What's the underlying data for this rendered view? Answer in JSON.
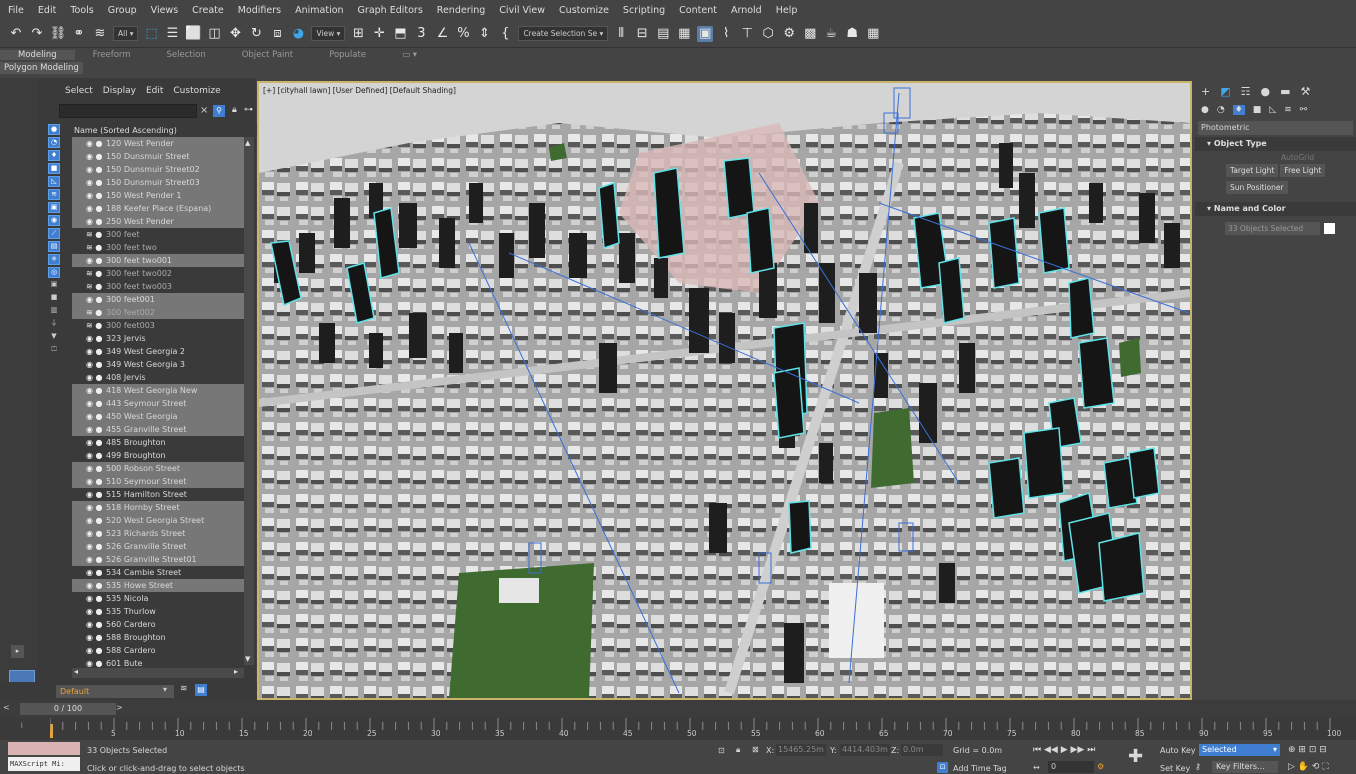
{
  "menu": [
    "File",
    "Edit",
    "Tools",
    "Group",
    "Views",
    "Create",
    "Modifiers",
    "Animation",
    "Graph Editors",
    "Rendering",
    "Civil View",
    "Customize",
    "Scripting",
    "Content",
    "Arnold",
    "Help"
  ],
  "toolbar": {
    "filter_select": "All",
    "view_select": "View",
    "selection_set": "Create Selection Se"
  },
  "ribbon": {
    "tabs": [
      "Modeling",
      "Freeform",
      "Selection",
      "Object Paint",
      "Populate"
    ],
    "active_tab": "Modeling",
    "sub_label": "Polygon Modeling"
  },
  "scene_explorer": {
    "menu": [
      "Select",
      "Display",
      "Edit",
      "Customize"
    ],
    "column_header": "Name (Sorted Ascending)",
    "items": [
      {
        "name": "120 West Pender",
        "type": "light",
        "state": "sel"
      },
      {
        "name": "150 Dunsmuir Street",
        "type": "light",
        "state": "sel"
      },
      {
        "name": "150 Dunsmuir Street02",
        "type": "light",
        "state": "sel"
      },
      {
        "name": "150 Dunsmuir Street03",
        "type": "light",
        "state": "sel"
      },
      {
        "name": "150 West Pender 1",
        "type": "light",
        "state": "sel"
      },
      {
        "name": "188 Keefer Place (Espana)",
        "type": "light",
        "state": "sel"
      },
      {
        "name": "250 West Pender",
        "type": "light",
        "state": "sel"
      },
      {
        "name": "300 feet",
        "type": "layer",
        "state": "dim"
      },
      {
        "name": "300 feet two",
        "type": "layer",
        "state": "dim"
      },
      {
        "name": "300 feet two001",
        "type": "light",
        "state": "sel"
      },
      {
        "name": "300 feet two002",
        "type": "layer",
        "state": "dim"
      },
      {
        "name": "300 feet two003",
        "type": "layer",
        "state": "dim"
      },
      {
        "name": "300 feet001",
        "type": "light",
        "state": "sel"
      },
      {
        "name": "300 feet002",
        "type": "layer",
        "state": "dimsel"
      },
      {
        "name": "300 feet003",
        "type": "layer",
        "state": "dim"
      },
      {
        "name": "323 Jervis",
        "type": "light",
        "state": "plain"
      },
      {
        "name": "349 West Georgia 2",
        "type": "light",
        "state": "plain"
      },
      {
        "name": "349 West Georgia 3",
        "type": "light",
        "state": "plain"
      },
      {
        "name": "408 Jervis",
        "type": "light",
        "state": "plain"
      },
      {
        "name": "418 West Georgia New",
        "type": "light",
        "state": "sel"
      },
      {
        "name": "443 Seymour Street",
        "type": "light",
        "state": "sel"
      },
      {
        "name": "450 West Georgia",
        "type": "light",
        "state": "sel"
      },
      {
        "name": "455 Granville Street",
        "type": "light",
        "state": "sel"
      },
      {
        "name": "485 Broughton",
        "type": "light",
        "state": "plain"
      },
      {
        "name": "499 Broughton",
        "type": "light",
        "state": "plain"
      },
      {
        "name": "500 Robson Street",
        "type": "light",
        "state": "sel"
      },
      {
        "name": "510 Seymour Street",
        "type": "light",
        "state": "sel"
      },
      {
        "name": "515 Hamilton Street",
        "type": "light",
        "state": "plain"
      },
      {
        "name": "518 Hornby Street",
        "type": "light",
        "state": "sel"
      },
      {
        "name": "520 West Georgia Street",
        "type": "light",
        "state": "sel"
      },
      {
        "name": "523 Richards Street",
        "type": "light",
        "state": "sel"
      },
      {
        "name": "526 Granville Street",
        "type": "light",
        "state": "sel"
      },
      {
        "name": "526 Granville Street01",
        "type": "light",
        "state": "sel"
      },
      {
        "name": "534 Cambie Street",
        "type": "light",
        "state": "plain"
      },
      {
        "name": "535 Howe Street",
        "type": "light",
        "state": "sel"
      },
      {
        "name": "535 Nicola",
        "type": "light",
        "state": "plain"
      },
      {
        "name": "535 Thurlow",
        "type": "light",
        "state": "plain"
      },
      {
        "name": "560 Cardero",
        "type": "light",
        "state": "plain"
      },
      {
        "name": "588 Broughton",
        "type": "light",
        "state": "plain"
      },
      {
        "name": "588 Cardero",
        "type": "light",
        "state": "plain"
      },
      {
        "name": "601 Bute",
        "type": "light",
        "state": "plain"
      }
    ],
    "layer": "Default"
  },
  "viewport": {
    "label": "[+] [cityhall lawn] [User Defined] [Default Shading]"
  },
  "command_panel": {
    "category": "Photometric",
    "object_type_title": "Object Type",
    "autogrid": "AutoGrid",
    "buttons": [
      "Target Light",
      "Free Light",
      "Sun Positioner"
    ],
    "name_color_title": "Name and Color",
    "name_field": "33 Objects Selected"
  },
  "timeline": {
    "frame": "0 / 100",
    "ticks": [
      "5",
      "10",
      "15",
      "20",
      "25",
      "30",
      "35",
      "40",
      "45",
      "50",
      "55",
      "60",
      "65",
      "70",
      "75",
      "80",
      "85",
      "90",
      "95",
      "100"
    ]
  },
  "status": {
    "maxscript": "MAXScript Mi:",
    "selected": "33 Objects Selected",
    "prompt": "Click or click-and-drag to select objects",
    "x_label": "X:",
    "x_value": "15465.25m",
    "y_label": "Y:",
    "y_value": "4414.403m",
    "z_label": "Z:",
    "z_value": "0.0m",
    "grid": "Grid = 0.0m",
    "add_time_tag": "Add Time Tag",
    "frame_field": "0",
    "auto_key": "Auto Key",
    "selected_dropdown": "Selected",
    "set_key": "Set Key",
    "key_filters": "Key Filters..."
  },
  "colors": {
    "selection_highlight": "#5fe3e8",
    "lights_blue": "#3a6fd8",
    "viewport_border": "#c8b56a",
    "layer_text": "#e6a23c"
  }
}
